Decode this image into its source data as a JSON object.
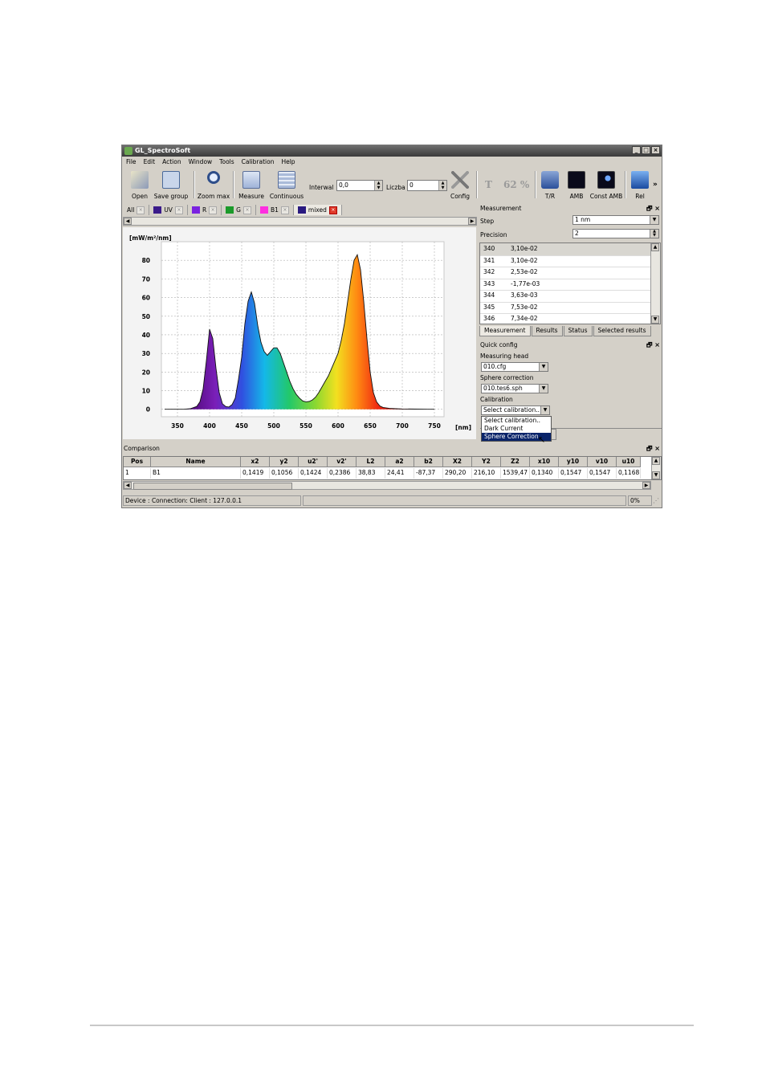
{
  "window": {
    "title": "GL_SpectroSoft",
    "min": "_",
    "max": "□",
    "close": "×"
  },
  "menu": [
    "File",
    "Edit",
    "Action",
    "Window",
    "Tools",
    "Calibration",
    "Help"
  ],
  "toolbar": {
    "open": "Open",
    "save_group": "Save group",
    "zoom_max": "Zoom max",
    "measure": "Measure",
    "continuous": "Continuous",
    "interwal_label": "Interwal",
    "interwal_value": "0,0",
    "liczba_label": "Liczba",
    "liczba_value": "0",
    "config": "Config",
    "t_label": "T",
    "t_value": "62 %",
    "tr": "T/R",
    "amb": "AMB",
    "const_amb": "Const AMB",
    "rel": "Rel",
    "more": "»"
  },
  "tabs": [
    {
      "label": "All",
      "color": ""
    },
    {
      "label": "UV",
      "color": "#3a1a8a"
    },
    {
      "label": "R",
      "color": "#7a22e0"
    },
    {
      "label": "G",
      "color": "#1b9a2a"
    },
    {
      "label": "B1",
      "color": "#ff2ee0"
    },
    {
      "label": "mixed",
      "color": "#2a1a80"
    }
  ],
  "chart_data": {
    "type": "area",
    "ylabel": "[mW/m²/nm]",
    "xunit": "[nm]",
    "xlim": [
      325,
      765
    ],
    "ylim": [
      -4,
      90
    ],
    "xticks": [
      350,
      400,
      450,
      500,
      550,
      600,
      650,
      700,
      750
    ],
    "yticks": [
      0,
      10,
      20,
      30,
      40,
      50,
      60,
      70,
      80
    ],
    "grid": true,
    "x": [
      330,
      340,
      350,
      360,
      370,
      380,
      385,
      390,
      395,
      400,
      405,
      410,
      415,
      420,
      425,
      430,
      435,
      440,
      445,
      450,
      455,
      460,
      465,
      470,
      475,
      480,
      485,
      490,
      495,
      500,
      505,
      510,
      515,
      520,
      525,
      530,
      535,
      540,
      545,
      550,
      555,
      560,
      565,
      570,
      575,
      580,
      585,
      590,
      595,
      600,
      605,
      610,
      615,
      620,
      625,
      630,
      635,
      640,
      645,
      650,
      655,
      660,
      665,
      670,
      680,
      690,
      700,
      720,
      740,
      750
    ],
    "y": [
      0,
      0,
      0,
      0,
      0.3,
      1.5,
      4,
      11,
      26,
      43,
      38,
      22,
      9,
      3,
      1.5,
      1.2,
      2.5,
      6,
      16,
      28,
      46,
      58,
      63,
      57,
      45,
      36,
      31,
      29,
      31,
      33,
      33,
      30,
      25,
      20,
      15,
      11,
      8,
      6,
      4.5,
      4,
      4.2,
      5,
      6.5,
      9,
      12,
      15,
      18,
      22,
      26,
      30,
      37,
      46,
      58,
      70,
      80,
      83,
      75,
      58,
      38,
      20,
      9,
      4,
      1.8,
      1,
      0.5,
      0.3,
      0.2,
      0.1,
      0,
      0
    ]
  },
  "measurement": {
    "title": "Measurement",
    "step_label": "Step",
    "step_value": "1 nm",
    "precision_label": "Precision",
    "precision_value": "2",
    "rows": [
      {
        "nm": "340",
        "val": "3,10e-02"
      },
      {
        "nm": "341",
        "val": "3,10e-02"
      },
      {
        "nm": "342",
        "val": "2,53e-02"
      },
      {
        "nm": "343",
        "val": "-1,77e-03"
      },
      {
        "nm": "344",
        "val": "3,63e-03"
      },
      {
        "nm": "345",
        "val": "7,53e-02"
      },
      {
        "nm": "346",
        "val": "7,34e-02"
      }
    ],
    "tabs": [
      "Measurement",
      "Results",
      "Status",
      "Selected results"
    ]
  },
  "quick_config": {
    "title": "Quick config",
    "head_label": "Measuring head",
    "head_value": "010.cfg",
    "sphere_label": "Sphere correction",
    "sphere_value": "010.tes6.sph",
    "calib_label": "Calibration",
    "calib_value": "Select calibration..",
    "options": [
      "Select calibration..",
      "Dark Current",
      "Sphere Correction"
    ]
  },
  "comparison": {
    "title": "Comparison",
    "headers": [
      "Pos",
      "Name",
      "x2",
      "y2",
      "u2'",
      "v2'",
      "L2",
      "a2",
      "b2",
      "X2",
      "Y2",
      "Z2",
      "x10",
      "y10",
      "v10",
      "u10"
    ],
    "row": [
      "1",
      "B1",
      "0,1419",
      "0,1056",
      "0,1424",
      "0,2386",
      "38,83",
      "24,41",
      "-87,37",
      "290,20",
      "216,10",
      "1539,47",
      "0,1340",
      "0,1547",
      "0,1547",
      "0,1168"
    ]
  },
  "status": {
    "device": "Device : Connection: Client : 127.0.0.1",
    "percent": "0%"
  },
  "panel_icons": {
    "float": "🗗",
    "close": "×"
  }
}
